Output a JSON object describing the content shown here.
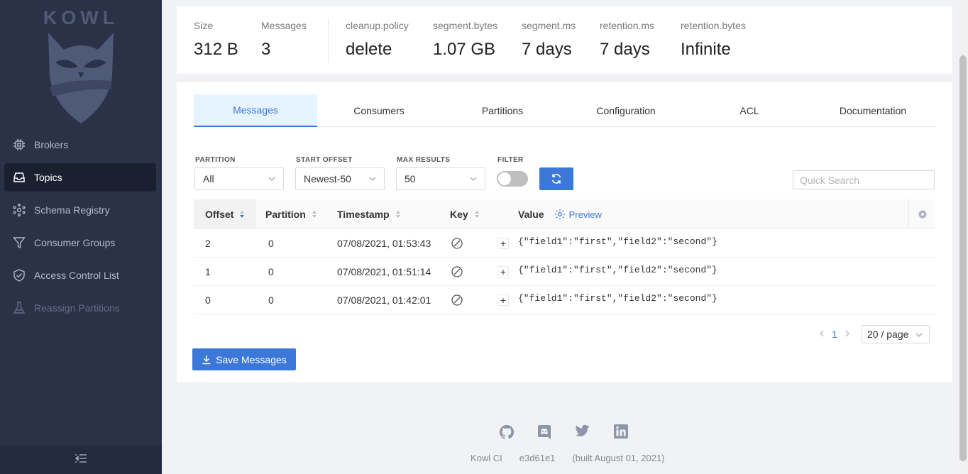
{
  "sidebar": {
    "logo_text": "KOWL",
    "items": [
      {
        "label": "Brokers",
        "icon": "cpu-icon",
        "state": "normal"
      },
      {
        "label": "Topics",
        "icon": "inbox-icon",
        "state": "active"
      },
      {
        "label": "Schema Registry",
        "icon": "share-nodes-icon",
        "state": "normal"
      },
      {
        "label": "Consumer Groups",
        "icon": "funnel-icon",
        "state": "normal"
      },
      {
        "label": "Access Control List",
        "icon": "shield-check-icon",
        "state": "normal"
      },
      {
        "label": "Reassign Partitions",
        "icon": "flask-icon",
        "state": "disabled"
      }
    ],
    "collapse_icon": "menu-fold-icon"
  },
  "stats": [
    {
      "label": "Size",
      "value": "312 B"
    },
    {
      "label": "Messages",
      "value": "3"
    },
    {
      "label": "cleanup.policy",
      "value": "delete"
    },
    {
      "label": "segment.bytes",
      "value": "1.07 GB"
    },
    {
      "label": "segment.ms",
      "value": "7 days"
    },
    {
      "label": "retention.ms",
      "value": "7 days"
    },
    {
      "label": "retention.bytes",
      "value": "Infinite"
    }
  ],
  "tabs": [
    "Messages",
    "Consumers",
    "Partitions",
    "Configuration",
    "ACL",
    "Documentation"
  ],
  "active_tab": "Messages",
  "filters": {
    "partition": {
      "label": "PARTITION",
      "value": "All"
    },
    "start_offset": {
      "label": "START OFFSET",
      "value": "Newest-50"
    },
    "max_results": {
      "label": "MAX RESULTS",
      "value": "50"
    },
    "filter": {
      "label": "FILTER",
      "enabled": false
    },
    "search_placeholder": "Quick Search"
  },
  "table": {
    "columns": {
      "offset": "Offset",
      "partition": "Partition",
      "timestamp": "Timestamp",
      "key": "Key",
      "value": "Value",
      "preview": "Preview"
    },
    "rows": [
      {
        "offset": "2",
        "partition": "0",
        "timestamp": "07/08/2021, 01:53:43",
        "value": "{\"field1\":\"first\",\"field2\":\"second\"}"
      },
      {
        "offset": "1",
        "partition": "0",
        "timestamp": "07/08/2021, 01:51:14",
        "value": "{\"field1\":\"first\",\"field2\":\"second\"}"
      },
      {
        "offset": "0",
        "partition": "0",
        "timestamp": "07/08/2021, 01:42:01",
        "value": "{\"field1\":\"first\",\"field2\":\"second\"}"
      }
    ]
  },
  "pagination": {
    "current_page": "1",
    "page_size": "20 / page"
  },
  "save_button": "Save Messages",
  "footer": {
    "icons": [
      "github-icon",
      "discord-icon",
      "twitter-icon",
      "linkedin-icon"
    ],
    "product": "Kowl CI",
    "commit": "e3d61e1",
    "built": "(built August 01, 2021)"
  },
  "colors": {
    "sidebar_bg": "#2b3147",
    "accent": "#3c78d8",
    "active_tab_bg": "#e6f4ff"
  }
}
